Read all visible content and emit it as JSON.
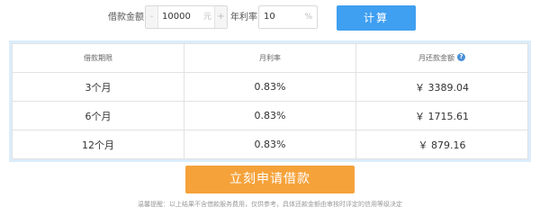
{
  "form": {
    "amount_label": "借款金额",
    "amount_minus": "-",
    "amount_value": "10000",
    "amount_unit": "元",
    "amount_plus": "+",
    "rate_label": "年利率",
    "rate_value": "10",
    "rate_unit": "%",
    "calc_label": "计算"
  },
  "table": {
    "headers": [
      "借款期限",
      "月利率",
      "月还款金额"
    ],
    "help_glyph": "?",
    "rows": [
      {
        "term": "3个月",
        "rate": "0.83%",
        "payment": "￥ 3389.04"
      },
      {
        "term": "6个月",
        "rate": "0.83%",
        "payment": "￥ 1715.61"
      },
      {
        "term": "12个月",
        "rate": "0.83%",
        "payment": "￥ 879.16"
      }
    ]
  },
  "apply_label": "立刻申请借款",
  "notice": "温馨提醒：以上结果不含借款服务费用，仅供参考，具体还款金额由审核时评定的信用等级决定",
  "colors": {
    "calc_button": "#3f9ff0",
    "apply_button": "#f5a23a",
    "table_border": "#dbedfb",
    "help_icon": "#4a8fd8"
  }
}
